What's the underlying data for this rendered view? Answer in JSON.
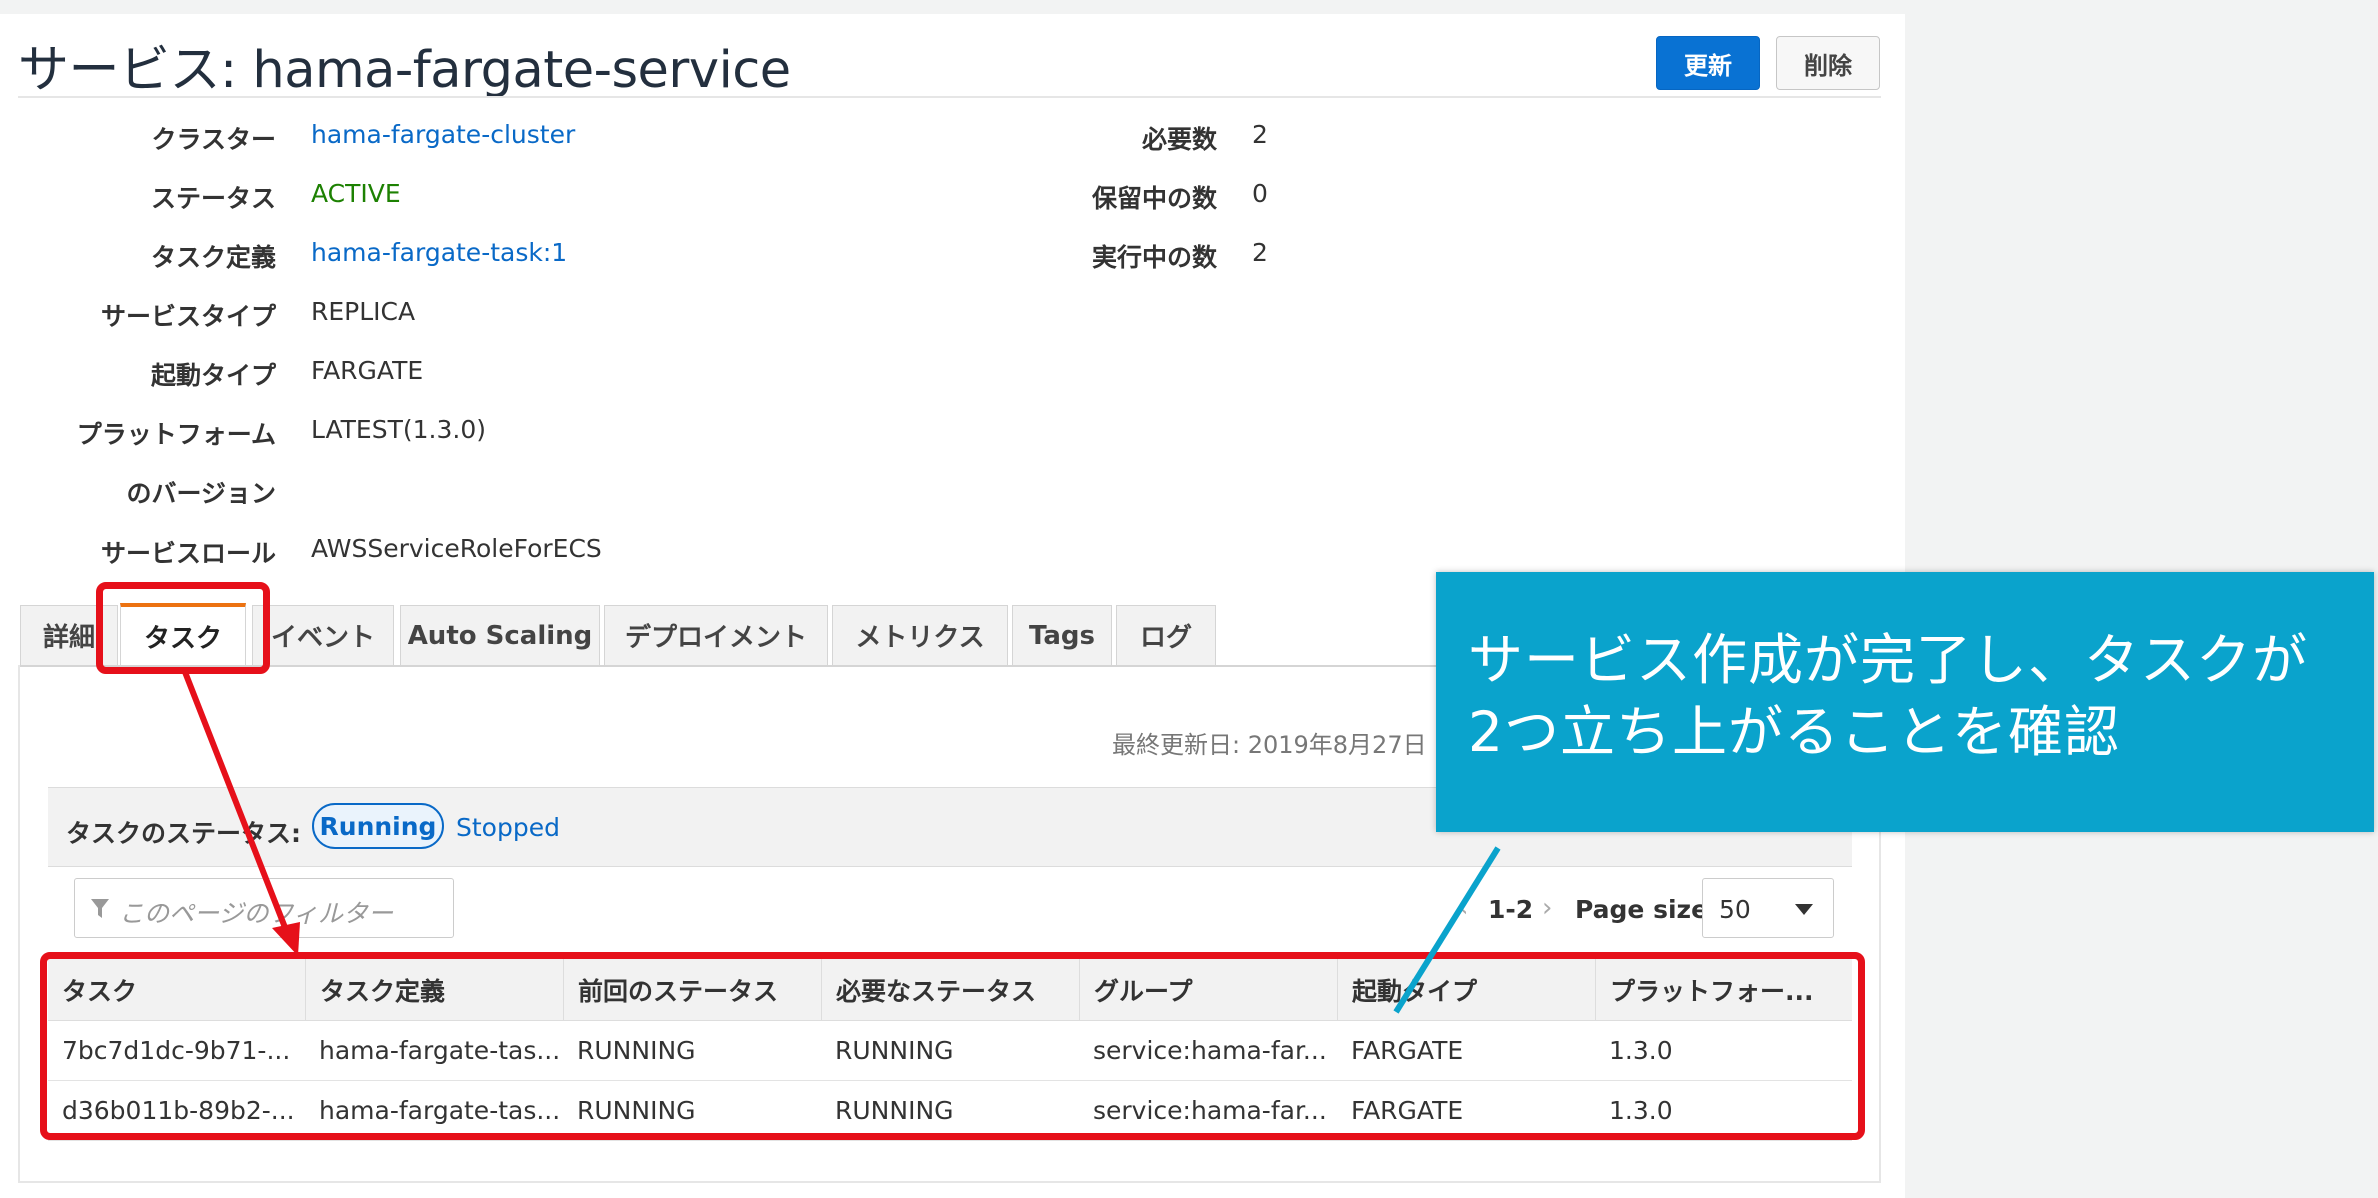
{
  "header": {
    "title": "サービス: hama-fargate-service",
    "update_button": "更新",
    "delete_button": "削除"
  },
  "details_left": [
    {
      "label": "クラスター",
      "value": "hama-fargate-cluster",
      "kind": "link"
    },
    {
      "label": "ステータス",
      "value": "ACTIVE",
      "kind": "status"
    },
    {
      "label": "タスク定義",
      "value": "hama-fargate-task:1",
      "kind": "link"
    },
    {
      "label": "サービスタイプ",
      "value": "REPLICA",
      "kind": "text"
    },
    {
      "label": "起動タイプ",
      "value": "FARGATE",
      "kind": "text"
    },
    {
      "label": "プラットフォーム",
      "value": "LATEST(1.3.0)",
      "kind": "text"
    },
    {
      "label": "のバージョン",
      "value": "",
      "kind": "text"
    },
    {
      "label": "サービスロール",
      "value": "AWSServiceRoleForECS",
      "kind": "text"
    }
  ],
  "details_right": [
    {
      "label": "必要数",
      "value": "2"
    },
    {
      "label": "保留中の数",
      "value": "0"
    },
    {
      "label": "実行中の数",
      "value": "2"
    }
  ],
  "tabs": [
    {
      "label": "詳細"
    },
    {
      "label": "タスク"
    },
    {
      "label": "イベント"
    },
    {
      "label": "Auto Scaling"
    },
    {
      "label": "デプロイメント"
    },
    {
      "label": "メトリクス"
    },
    {
      "label": "Tags"
    },
    {
      "label": "ログ"
    }
  ],
  "active_tab": "タスク",
  "last_updated": "最終更新日: 2019年8月27日",
  "task_status": {
    "label": "タスクのステータス:",
    "running": "Running",
    "stopped": "Stopped"
  },
  "filter": {
    "placeholder": "このページのフィルター"
  },
  "pagination": {
    "prev": "‹",
    "range": "1-2",
    "next": "›",
    "page_size_label": "Page size",
    "page_size": "50"
  },
  "table": {
    "headers": [
      "タスク",
      "タスク定義",
      "前回のステータス",
      "必要なステータス",
      "グループ",
      "起動タイプ",
      "プラットフォー..."
    ],
    "rows": [
      [
        "7bc7d1dc-9b71-...",
        "hama-fargate-tas...",
        "RUNNING",
        "RUNNING",
        "service:hama-far...",
        "FARGATE",
        "1.3.0"
      ],
      [
        "d36b011b-89b2-...",
        "hama-fargate-tas...",
        "RUNNING",
        "RUNNING",
        "service:hama-far...",
        "FARGATE",
        "1.3.0"
      ]
    ]
  },
  "callout": {
    "line1": "サービス作成が完了し、タスクが",
    "line2": "2つ立ち上がることを確認"
  },
  "colors": {
    "link": "#0969c7",
    "status_ok": "#1d8102",
    "primary": "#0972d3",
    "highlight": "#e6101a",
    "callout_bg": "#0aa3cc",
    "tab_accent": "#ec7211"
  }
}
